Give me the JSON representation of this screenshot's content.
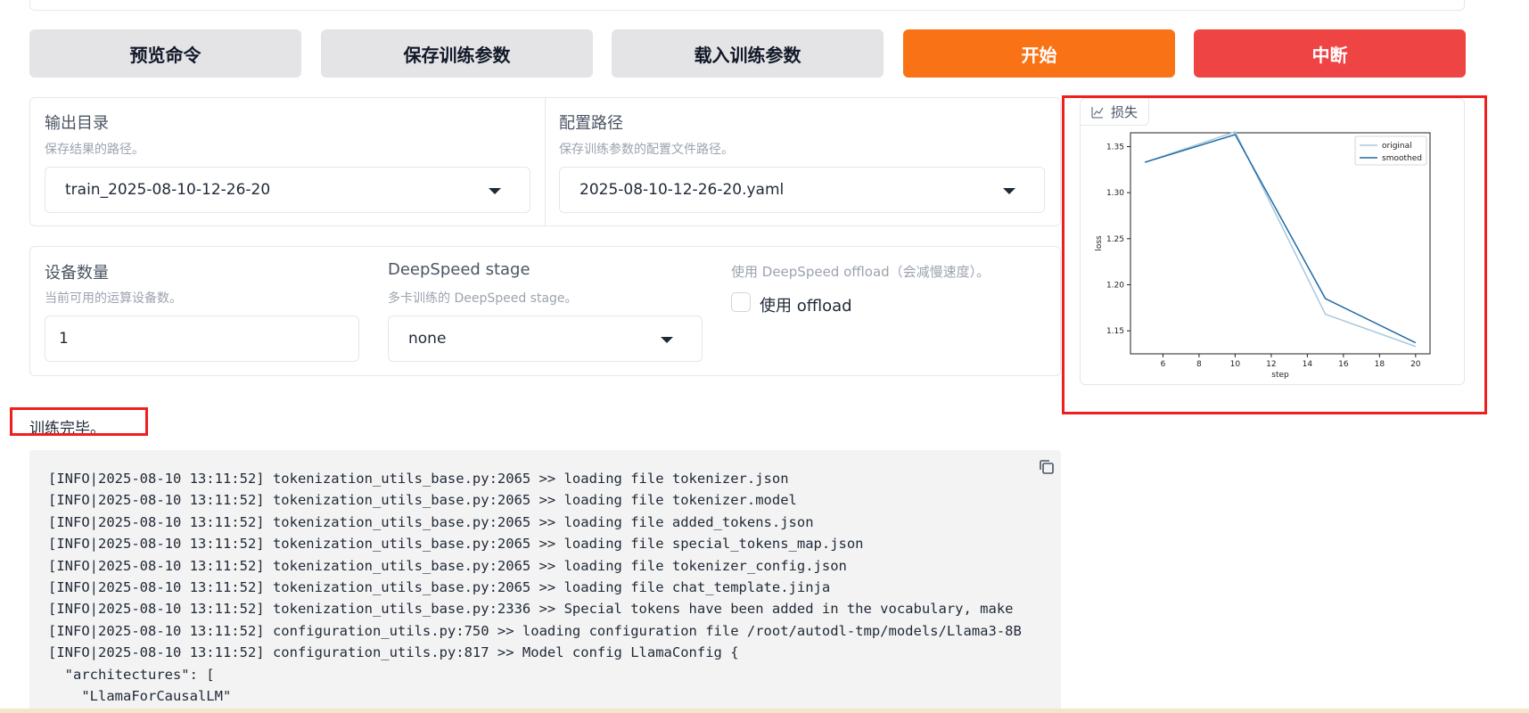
{
  "buttons": {
    "preview": "预览命令",
    "save_args": "保存训练参数",
    "load_args": "载入训练参数",
    "start": "开始",
    "abort": "中断"
  },
  "output_dir": {
    "label": "输出目录",
    "info": "保存结果的路径。",
    "value": "train_2025-08-10-12-26-20"
  },
  "config_path": {
    "label": "配置路径",
    "info": "保存训练参数的配置文件路径。",
    "value": "2025-08-10-12-26-20.yaml"
  },
  "device_count": {
    "label": "设备数量",
    "info": "当前可用的运算设备数。",
    "value": "1"
  },
  "ds_stage": {
    "label": "DeepSpeed stage",
    "info": "多卡训练的 DeepSpeed stage。",
    "value": "none"
  },
  "ds_offload": {
    "info": "使用 DeepSpeed offload（会减慢速度）。",
    "label": "使用 offload",
    "checked": false
  },
  "loss_tab": {
    "label": "损失",
    "icon": "chart-icon"
  },
  "status": "训练完毕。",
  "log_lines": [
    "[INFO|2025-08-10 13:11:52] tokenization_utils_base.py:2065 >> loading file tokenizer.json",
    "[INFO|2025-08-10 13:11:52] tokenization_utils_base.py:2065 >> loading file tokenizer.model",
    "[INFO|2025-08-10 13:11:52] tokenization_utils_base.py:2065 >> loading file added_tokens.json",
    "[INFO|2025-08-10 13:11:52] tokenization_utils_base.py:2065 >> loading file special_tokens_map.json",
    "[INFO|2025-08-10 13:11:52] tokenization_utils_base.py:2065 >> loading file tokenizer_config.json",
    "[INFO|2025-08-10 13:11:52] tokenization_utils_base.py:2065 >> loading file chat_template.jinja",
    "[INFO|2025-08-10 13:11:52] tokenization_utils_base.py:2336 >> Special tokens have been added in the vocabulary, make",
    "[INFO|2025-08-10 13:11:52] configuration_utils.py:750 >> loading configuration file /root/autodl-tmp/models/Llama3-8B",
    "[INFO|2025-08-10 13:11:52] configuration_utils.py:817 >> Model config LlamaConfig {",
    "  \"architectures\": [",
    "    \"LlamaForCausalLM\""
  ],
  "chart_data": {
    "type": "line",
    "xlabel": "step",
    "ylabel": "loss",
    "xlim": [
      4.2,
      20.8
    ],
    "ylim": [
      1.125,
      1.365
    ],
    "xticks": [
      "6",
      "8",
      "10",
      "12",
      "14",
      "16",
      "18",
      "20"
    ],
    "yticks": [
      "1.15",
      "1.20",
      "1.25",
      "1.30",
      "1.35"
    ],
    "legend_position": "top-right",
    "series": [
      {
        "name": "original",
        "color": "#a6c8dd",
        "x": [
          5,
          10,
          15,
          20
        ],
        "values": [
          1.333,
          1.366,
          1.168,
          1.133
        ]
      },
      {
        "name": "smoothed",
        "color": "#1f6aa5",
        "x": [
          5,
          10,
          15,
          20
        ],
        "values": [
          1.333,
          1.363,
          1.185,
          1.137
        ]
      }
    ]
  }
}
